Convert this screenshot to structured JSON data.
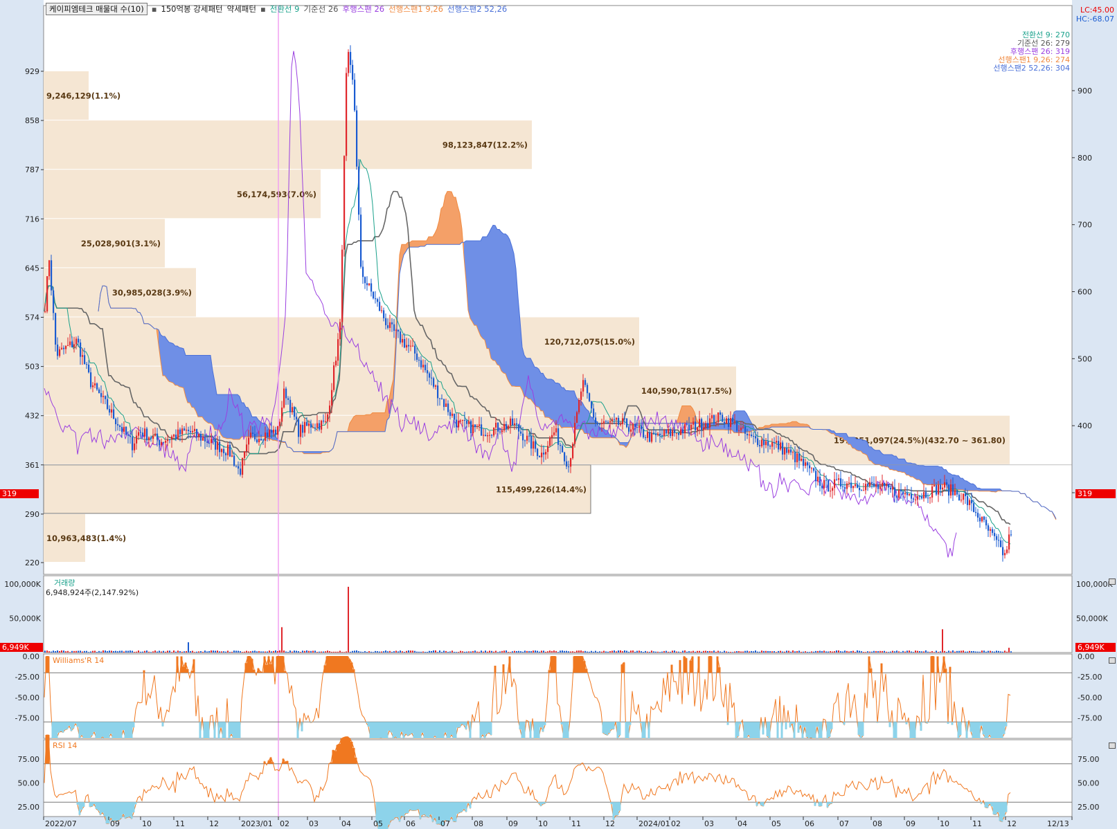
{
  "legend": {
    "stock_box": "케이피엠테크 매물대 수(10)",
    "bullet": "▪",
    "pattern_strong": "150억봉 강세패턴",
    "pattern_weak": "약세패턴",
    "tenkan": "전환선 9",
    "kijun": "기준선 26",
    "chikou": "후행스팬 26",
    "senkou1": "선행스팬1 9,26",
    "senkou2": "선행스팬2 52,26"
  },
  "right_legend": {
    "tenkan": "전환선 9: 270",
    "kijun": "기준선 26: 279",
    "chikou": "후행스팬 26: 319",
    "senkou1": "선행스팬1 9,26: 274",
    "senkou2": "선행스팬2 52,26: 304"
  },
  "corner": {
    "lc": "LC:45.00",
    "hc": "HC:-68.07"
  },
  "price_tag": "319",
  "volume": {
    "title": "거래량",
    "subtitle": "6,948,924주(2,147.92%)",
    "tag": "6,949K"
  },
  "williams": {
    "title": "Williams'R 14"
  },
  "rsi": {
    "title": "RSI 14"
  },
  "colors": {
    "up": "#e0262b",
    "down": "#1a5bd1",
    "cloud_bull": "#f4a068",
    "cloud_bear": "#6f8fe6",
    "tenkan": "#1aa18b",
    "kijun": "#666666",
    "chikou": "#9a3fe0",
    "vp": "#f5e6d3",
    "osc": "#f07820",
    "osc_fill": "#8dd3ea"
  },
  "chart_data": [
    {
      "type": "candlestick",
      "title": "케이피엠테크 매물대 수(10)",
      "y_left_ticks": [
        "929",
        "858",
        "787",
        "716",
        "645",
        "574",
        "503",
        "432",
        "361",
        "290",
        "220"
      ],
      "y_right_ticks": [
        "900",
        "800",
        "700",
        "600",
        "500",
        "400",
        "300"
      ],
      "x_ticks": [
        "2022/07",
        "09",
        "10",
        "11",
        "12",
        "2023/01",
        "02",
        "03",
        "04",
        "05",
        "06",
        "07",
        "08",
        "09",
        "10",
        "11",
        "12",
        "2024/01",
        "02",
        "03",
        "04",
        "05",
        "06",
        "07",
        "08",
        "09",
        "10",
        "11",
        "12",
        "12/13"
      ],
      "current_price": 319,
      "ylim": [
        220,
        1000
      ],
      "volume_profile": [
        {
          "low": 220,
          "high": 290,
          "label": "10,963,483(1.4%)"
        },
        {
          "low": 290,
          "high": 361,
          "label": "115,499,226(14.4%)"
        },
        {
          "low": 361,
          "high": 432,
          "label": "197,251,097(24.5%)(432.70 ~ 361.80)"
        },
        {
          "low": 432,
          "high": 503,
          "label": "140,590,781(17.5%)"
        },
        {
          "low": 503,
          "high": 574,
          "label": "120,712,075(15.0%)"
        },
        {
          "low": 574,
          "high": 645,
          "label": "30,985,028(3.9%)"
        },
        {
          "low": 645,
          "high": 716,
          "label": "25,028,901(3.1%)"
        },
        {
          "low": 716,
          "high": 787,
          "label": "56,174,593(7.0%)"
        },
        {
          "low": 787,
          "high": 858,
          "label": "98,123,847(12.2%)"
        },
        {
          "low": 858,
          "high": 929,
          "label": "9,246,129(1.1%)"
        }
      ]
    },
    {
      "type": "bar",
      "title": "거래량",
      "y_ticks": [
        "100,000K",
        "50,000K"
      ],
      "ylim": [
        0,
        100000
      ],
      "peak_values_K": [
        96000,
        37000,
        34000,
        15000,
        6949
      ]
    },
    {
      "type": "line",
      "title": "Williams'R 14",
      "y_ticks": [
        "0.00",
        "-25.00",
        "-50.00",
        "-75.00"
      ],
      "ylim": [
        -100,
        0
      ],
      "reference_lines": [
        -20,
        -80
      ]
    },
    {
      "type": "line",
      "title": "RSI 14",
      "y_ticks": [
        "75.00",
        "50.00",
        "25.00"
      ],
      "ylim": [
        15,
        95
      ],
      "reference_lines": [
        30,
        70
      ]
    }
  ]
}
